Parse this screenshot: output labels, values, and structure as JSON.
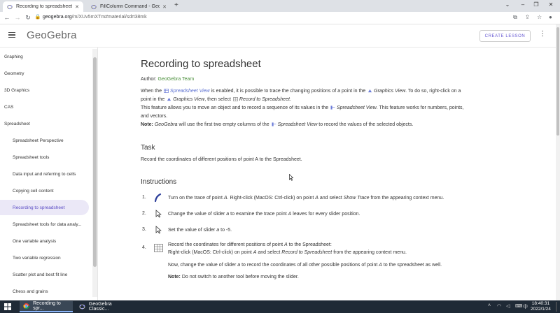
{
  "browser": {
    "tabs": [
      {
        "title": "Recording to spreadsheet – Ge",
        "active": true
      },
      {
        "title": "FillColumn Command - GeoGe",
        "active": false
      }
    ],
    "new_tab": "+",
    "url_host": "geogebra.org",
    "url_path": "/m/XUv5mXTm#material/sdrt38mk",
    "win_minimize": "–",
    "win_maximize": "❐",
    "win_close": "✕",
    "tabs_menu": "⌄"
  },
  "header": {
    "logo": "GeoGebra",
    "create_lesson": "CREATE LESSON",
    "more": "⋮"
  },
  "sidebar": {
    "items": [
      {
        "label": "Graphing",
        "sub": false,
        "active": false
      },
      {
        "label": "Geometry",
        "sub": false,
        "active": false
      },
      {
        "label": "3D Graphics",
        "sub": false,
        "active": false
      },
      {
        "label": "CAS",
        "sub": false,
        "active": false
      },
      {
        "label": "Spreadsheet",
        "sub": false,
        "active": false
      },
      {
        "label": "Spreadsheet Perspective",
        "sub": true,
        "active": false
      },
      {
        "label": "Spreadsheet tools",
        "sub": true,
        "active": false
      },
      {
        "label": "Data input and referring to cells",
        "sub": true,
        "active": false
      },
      {
        "label": "Copying cell content",
        "sub": true,
        "active": false
      },
      {
        "label": "Recording to spreadsheet",
        "sub": true,
        "active": true
      },
      {
        "label": "Spreadsheet tools for data analy...",
        "sub": true,
        "active": false
      },
      {
        "label": "One variable analysis",
        "sub": true,
        "active": false
      },
      {
        "label": "Two variable regression",
        "sub": true,
        "active": false
      },
      {
        "label": "Scatter plot and best fit line",
        "sub": true,
        "active": false
      },
      {
        "label": "Chess and grains",
        "sub": true,
        "active": false
      }
    ]
  },
  "content": {
    "title": "Recording to spreadsheet",
    "author_label": "Author:",
    "author_name": "GeoGebra Team",
    "intro": {
      "p1a": "When the",
      "p1b": "Spreadsheet View",
      "p1c": "is enabled, it is possible to trace the changing positions of a point in the",
      "p1d": "Graphics View",
      "p1e": ". To do so, right-click on a",
      "p2a": "point in the",
      "p2b": "Graphics View",
      "p2c": ", then select",
      "p2d": "Record to Spreadsheet",
      "p2e": ".",
      "p3a": "This feature allows you to move an object and to record a sequence of its values in the",
      "p3b": "Spreadsheet View",
      "p3c": ". This feature works for numbers, points,",
      "p4": "and vectors.",
      "note_label": "Note:",
      "note_a": "GeoGebra",
      "note_b": "will use the first two empty columns of the",
      "note_c": "Spreadsheet View",
      "note_d": "to record the values of the selected objects."
    },
    "task_heading": "Task",
    "task_text": "Record the coordinates of different positions of point A to the Spreadsheet.",
    "instructions_heading": "Instructions",
    "steps": [
      {
        "num": "1.",
        "icon": "trace-icon",
        "a": "Turn on the trace of point",
        "b": "A",
        "c": ". Right-click (MacOS: Ctrl-click) on point",
        "d": "A",
        "e": "and select",
        "f": "Show Trace",
        "g": "from the appearing context menu."
      },
      {
        "num": "2.",
        "icon": "move-icon",
        "a": "Change the value of slider",
        "b": "a",
        "c": "to examine the trace point",
        "d": "A",
        "e": "leaves for every slider position."
      },
      {
        "num": "3.",
        "icon": "move-icon",
        "a": "Set the value of slider",
        "b": "a",
        "c": "to -5."
      },
      {
        "num": "4.",
        "icon": "spreadsheet-icon",
        "l1a": "Record the coordinates for different positions of point",
        "l1b": "A",
        "l1c": "to the Spreadsheet:",
        "l2a": "Right-click (MacOS: Ctrl-click) on point",
        "l2b": "A",
        "l2c": "and select",
        "l2d": "Record to Spreadsheet",
        "l2e": "from the appearing context menu.",
        "l3a": "Now, change the value of slider",
        "l3b": "a",
        "l3c": "to record the coordinates of all other possible positions of point",
        "l3d": "A",
        "l3e": "to the spreadsheet as well.",
        "note_label": "Note:",
        "note_text": "Do not switch to another tool before moving the slider."
      }
    ]
  },
  "taskbar": {
    "apps": [
      {
        "title": "Recording to spr...",
        "active": true
      },
      {
        "title": "GeoGebra Classic...",
        "active": false
      }
    ],
    "time": "18:40:31",
    "date": "2022/1/24"
  }
}
